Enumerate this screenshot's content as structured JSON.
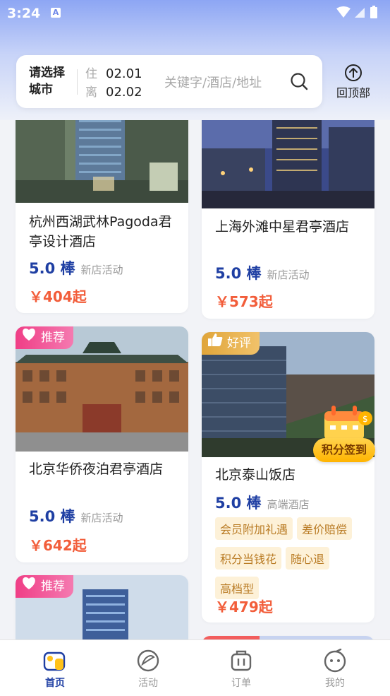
{
  "status": {
    "time": "3:24",
    "a_icon": "A"
  },
  "search": {
    "city_prompt": "请选择城市",
    "checkin_label": "住",
    "checkin_date": "02.01",
    "checkout_label": "离",
    "checkout_date": "02.02",
    "placeholder": "关键字/酒店/地址"
  },
  "to_top": {
    "label": "回顶部"
  },
  "hotels": [
    {
      "name": "杭州西湖武林Pagoda君亭设计酒店",
      "score": "5.0 棒",
      "level": "新店活动",
      "price": "￥404起"
    },
    {
      "name": "上海外滩中星君亭酒店",
      "score": "5.0 棒",
      "level": "新店活动",
      "price": "￥573起"
    },
    {
      "badge": "推荐",
      "name": "北京华侨夜泊君亭酒店",
      "score": "5.0 棒",
      "level": "新店活动",
      "price": "￥642起"
    },
    {
      "badge": "好评",
      "name": "北京泰山饭店",
      "score": "5.0 棒",
      "level": "高端酒店",
      "tags": [
        "会员附加礼遇",
        "差价赔偿",
        "积分当钱花",
        "随心退",
        "高档型"
      ],
      "price": "￥479起"
    },
    {
      "badge": "推荐"
    }
  ],
  "checkin_widget": {
    "label": "积分签到"
  },
  "tabs": [
    {
      "label": "首页",
      "icon": "home-icon",
      "active": true
    },
    {
      "label": "活动",
      "icon": "activity-icon",
      "active": false
    },
    {
      "label": "订单",
      "icon": "order-icon",
      "active": false
    },
    {
      "label": "我的",
      "icon": "profile-icon",
      "active": false
    }
  ],
  "colors": {
    "accent": "#1f3fa3",
    "price": "#f25d3a",
    "badge_pink": "#f03e86",
    "badge_gold": "#e0a53a"
  }
}
